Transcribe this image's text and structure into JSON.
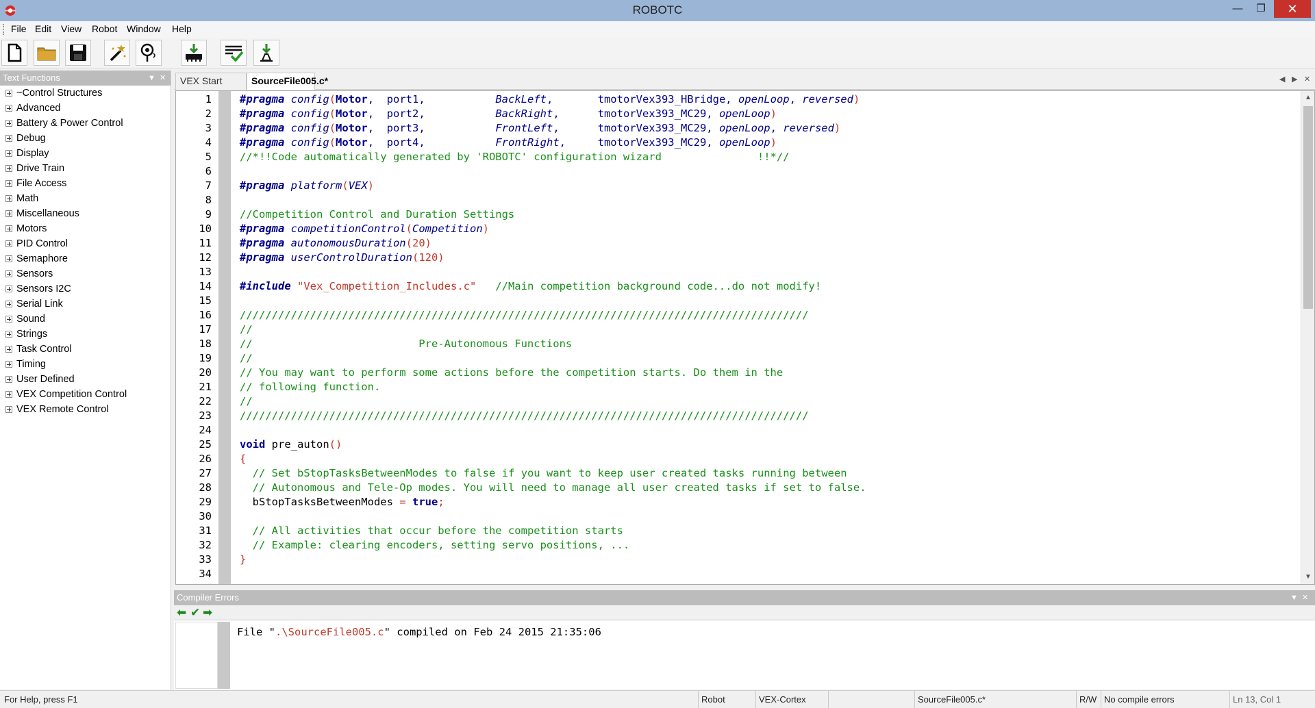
{
  "window": {
    "title": "ROBOTC",
    "minimize": "—",
    "maximize": "❐",
    "close": "✕"
  },
  "menu": [
    "File",
    "Edit",
    "View",
    "Robot",
    "Window",
    "Help"
  ],
  "toolbar": [
    {
      "name": "new-file-button",
      "icon": "new-file-icon"
    },
    {
      "name": "open-file-button",
      "icon": "folder-icon"
    },
    {
      "name": "save-button",
      "icon": "floppy-disk-icon"
    },
    {
      "name": "motor-sensor-setup-button",
      "icon": "magic-wand-icon"
    },
    {
      "name": "firmware-download-button",
      "icon": "robot-probe-icon"
    },
    {
      "name": "download-to-robot-button",
      "icon": "download-chip-icon"
    },
    {
      "name": "compile-program-button",
      "icon": "compile-check-icon"
    },
    {
      "name": "download-firmware-button",
      "icon": "download-arrow-icon"
    }
  ],
  "text_functions": {
    "title": "Text Functions",
    "items": [
      "~Control Structures",
      "Advanced",
      "Battery & Power Control",
      "Debug",
      "Display",
      "Drive Train",
      "File Access",
      "Math",
      "Miscellaneous",
      "Motors",
      "PID Control",
      "Semaphore",
      "Sensors",
      "Sensors I2C",
      "Serial Link",
      "Sound",
      "Strings",
      "Task Control",
      "Timing",
      "User Defined",
      "VEX Competition Control",
      "VEX Remote Control"
    ]
  },
  "tabs": [
    {
      "label": "VEX Start Page",
      "active": false
    },
    {
      "label": "SourceFile005.c*",
      "active": true
    }
  ],
  "editor": {
    "line_numbers": [
      "1",
      "2",
      "3",
      "4",
      "5",
      "6",
      "7",
      "8",
      "9",
      "10",
      "11",
      "12",
      "13",
      "14",
      "15",
      "16",
      "17",
      "18",
      "19",
      "20",
      "21",
      "22",
      "23",
      "24",
      "25",
      "26",
      "27",
      "28",
      "29",
      "30",
      "31",
      "32",
      "33",
      "34"
    ],
    "lines": [
      [
        [
          "kw",
          "#pragma"
        ],
        [
          "tx",
          " "
        ],
        [
          "fn",
          "config"
        ],
        [
          "p",
          "("
        ],
        [
          "bold",
          "Motor"
        ],
        [
          "id",
          ",  port1,           "
        ],
        [
          "fn",
          "BackLeft"
        ],
        [
          "id",
          ",       tmotorVex393_HBridge, "
        ],
        [
          "fn",
          "openLoop"
        ],
        [
          "id",
          ", "
        ],
        [
          "fn",
          "reversed"
        ],
        [
          "p",
          ")"
        ]
      ],
      [
        [
          "kw",
          "#pragma"
        ],
        [
          "tx",
          " "
        ],
        [
          "fn",
          "config"
        ],
        [
          "p",
          "("
        ],
        [
          "bold",
          "Motor"
        ],
        [
          "id",
          ",  port2,           "
        ],
        [
          "fn",
          "BackRight"
        ],
        [
          "id",
          ",      tmotorVex393_MC29, "
        ],
        [
          "fn",
          "openLoop"
        ],
        [
          "p",
          ")"
        ]
      ],
      [
        [
          "kw",
          "#pragma"
        ],
        [
          "tx",
          " "
        ],
        [
          "fn",
          "config"
        ],
        [
          "p",
          "("
        ],
        [
          "bold",
          "Motor"
        ],
        [
          "id",
          ",  port3,           "
        ],
        [
          "fn",
          "FrontLeft"
        ],
        [
          "id",
          ",      tmotorVex393_MC29, "
        ],
        [
          "fn",
          "openLoop"
        ],
        [
          "id",
          ", "
        ],
        [
          "fn",
          "reversed"
        ],
        [
          "p",
          ")"
        ]
      ],
      [
        [
          "kw",
          "#pragma"
        ],
        [
          "tx",
          " "
        ],
        [
          "fn",
          "config"
        ],
        [
          "p",
          "("
        ],
        [
          "bold",
          "Motor"
        ],
        [
          "id",
          ",  port4,           "
        ],
        [
          "fn",
          "FrontRight"
        ],
        [
          "id",
          ",     tmotorVex393_MC29, "
        ],
        [
          "fn",
          "openLoop"
        ],
        [
          "p",
          ")"
        ]
      ],
      [
        [
          "cm",
          "//*!!Code automatically generated by 'ROBOTC' configuration wizard               !!*//"
        ]
      ],
      [],
      [
        [
          "kw",
          "#pragma"
        ],
        [
          "tx",
          " "
        ],
        [
          "fn",
          "platform"
        ],
        [
          "p",
          "("
        ],
        [
          "fn",
          "VEX"
        ],
        [
          "p",
          ")"
        ]
      ],
      [],
      [
        [
          "cm",
          "//Competition Control and Duration Settings"
        ]
      ],
      [
        [
          "kw",
          "#pragma"
        ],
        [
          "tx",
          " "
        ],
        [
          "fn",
          "competitionControl"
        ],
        [
          "p",
          "("
        ],
        [
          "fn",
          "Competition"
        ],
        [
          "p",
          ")"
        ]
      ],
      [
        [
          "kw",
          "#pragma"
        ],
        [
          "tx",
          " "
        ],
        [
          "fn",
          "autonomousDuration"
        ],
        [
          "p",
          "(20)"
        ]
      ],
      [
        [
          "kw",
          "#pragma"
        ],
        [
          "tx",
          " "
        ],
        [
          "fn",
          "userControlDuration"
        ],
        [
          "p",
          "(120)"
        ]
      ],
      [],
      [
        [
          "kw",
          "#include"
        ],
        [
          "tx",
          " "
        ],
        [
          "str",
          "\"Vex_Competition_Includes.c\""
        ],
        [
          "tx",
          "   "
        ],
        [
          "cm",
          "//Main competition background code...do not modify!"
        ]
      ],
      [],
      [
        [
          "cm",
          "/////////////////////////////////////////////////////////////////////////////////////////"
        ]
      ],
      [
        [
          "cm",
          "//"
        ]
      ],
      [
        [
          "cm",
          "//                          Pre-Autonomous Functions"
        ]
      ],
      [
        [
          "cm",
          "//"
        ]
      ],
      [
        [
          "cm",
          "// You may want to perform some actions before the competition starts. Do them in the"
        ]
      ],
      [
        [
          "cm",
          "// following function."
        ]
      ],
      [
        [
          "cm",
          "//"
        ]
      ],
      [
        [
          "cm",
          "/////////////////////////////////////////////////////////////////////////////////////////"
        ]
      ],
      [],
      [
        [
          "bold",
          "void"
        ],
        [
          "tx",
          " pre_auton"
        ],
        [
          "p",
          "()"
        ]
      ],
      [
        [
          "p",
          "{"
        ]
      ],
      [
        [
          "tx",
          "  "
        ],
        [
          "cm",
          "// Set bStopTasksBetweenModes to false if you want to keep user created tasks running between"
        ]
      ],
      [
        [
          "tx",
          "  "
        ],
        [
          "cm",
          "// Autonomous and Tele-Op modes. You will need to manage all user created tasks if set to false."
        ]
      ],
      [
        [
          "tx",
          "  bStopTasksBetweenModes "
        ],
        [
          "p",
          "="
        ],
        [
          "tx",
          " "
        ],
        [
          "bold",
          "true"
        ],
        [
          "p",
          ";"
        ]
      ],
      [],
      [
        [
          "tx",
          "  "
        ],
        [
          "cm",
          "// All activities that occur before the competition starts"
        ]
      ],
      [
        [
          "tx",
          "  "
        ],
        [
          "cm",
          "// Example: clearing encoders, setting servo positions, ..."
        ]
      ],
      [
        [
          "p",
          "}"
        ]
      ],
      []
    ]
  },
  "compiler_errors": {
    "title": "Compiler Errors",
    "tools": [
      "⬅",
      "✔",
      "➡"
    ],
    "message_prefix": "File \"",
    "message_path": ".\\SourceFile005.c",
    "message_suffix": "\" compiled on Feb 24 2015 21:35:06"
  },
  "status": {
    "help": "For Help, press F1",
    "robot": "Robot",
    "platform": "VEX-Cortex",
    "file": "SourceFile005.c*",
    "rw": "R/W",
    "compile_status": "No compile errors",
    "position": "Ln 13, Col 1"
  },
  "colors": {
    "titlebar": "#9bb5d6",
    "close": "#c7312c",
    "keyword": "#00008b",
    "comment": "#1a8f1a",
    "paren": "#c0392b"
  }
}
